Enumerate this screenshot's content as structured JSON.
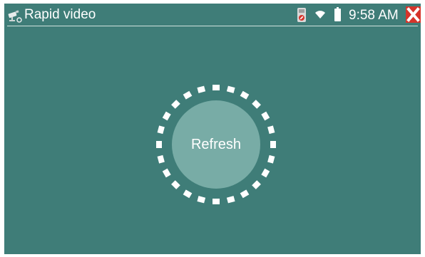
{
  "app": {
    "title": "Rapid video",
    "icon": "cctv-camera-icon"
  },
  "status_bar": {
    "time": "9:58 AM",
    "icons": [
      "storage-card-icon",
      "wifi-icon",
      "battery-icon"
    ]
  },
  "close_button": {
    "icon": "close-icon"
  },
  "main": {
    "refresh_label": "Refresh",
    "spinner_icon": "loading-dots-icon"
  },
  "colors": {
    "background": "#3f7d78",
    "refresh_circle": "#78aca6",
    "spinner_dots": "#ffffff",
    "close_button": "#d6342b",
    "text": "#ffffff"
  }
}
